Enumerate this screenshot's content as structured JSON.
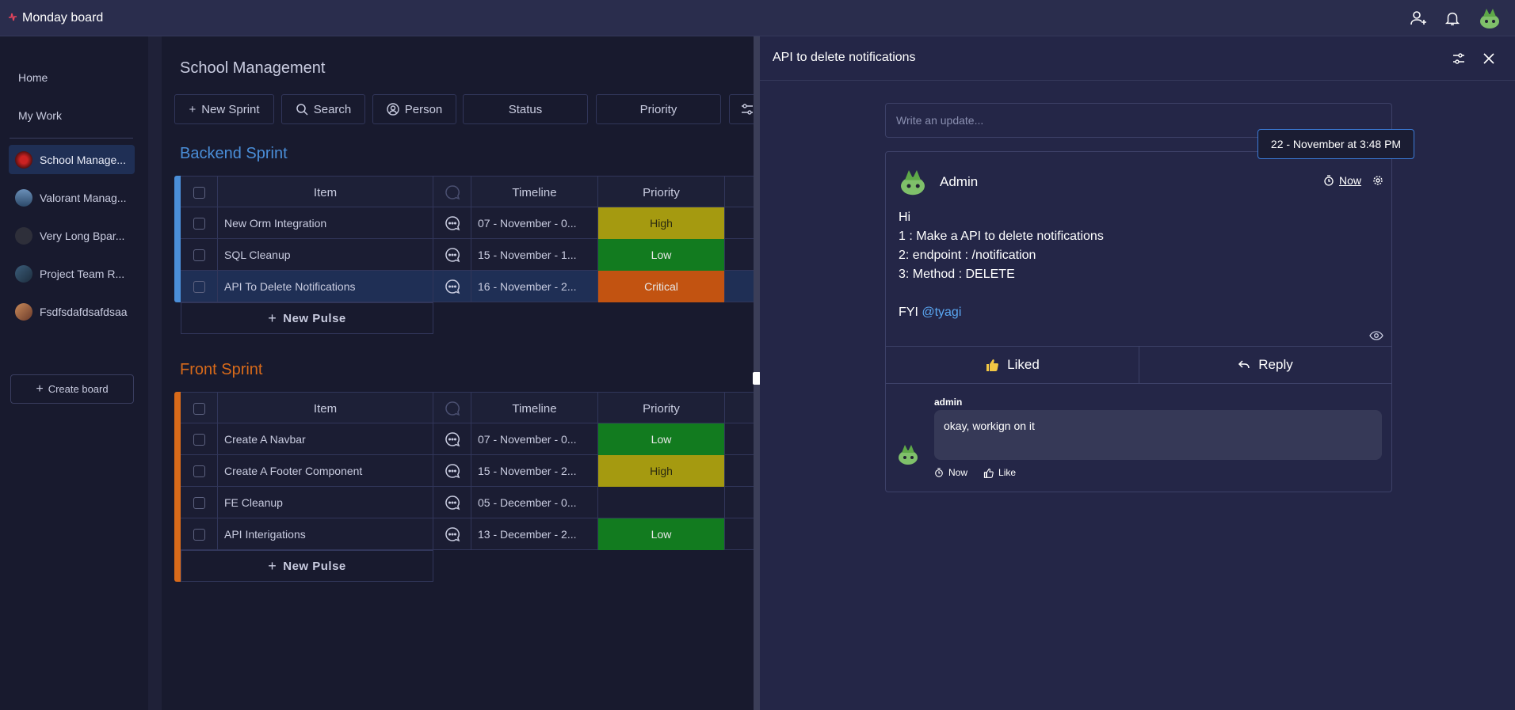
{
  "app": {
    "title": "Monday board"
  },
  "sidebar": {
    "links": [
      {
        "label": "Home"
      },
      {
        "label": "My Work"
      }
    ],
    "boards": [
      {
        "label": "School Manage...",
        "active": true
      },
      {
        "label": "Valorant Manag..."
      },
      {
        "label": "Very Long Bpar..."
      },
      {
        "label": "Project Team R..."
      },
      {
        "label": "Fsdfsdafdsafdsaa"
      }
    ],
    "create_label": "Create board"
  },
  "board": {
    "title": "School Management",
    "toolbar": {
      "new_sprint": "New Sprint",
      "search": "Search",
      "person": "Person",
      "status": "Status",
      "priority": "Priority"
    },
    "columns": {
      "item": "Item",
      "timeline": "Timeline",
      "priority": "Priority"
    },
    "new_pulse_label": "New Pulse",
    "groups": [
      {
        "title": "Backend Sprint",
        "color": "#4a8ed8",
        "rows": [
          {
            "item": "New Orm Integration",
            "timeline": "07 - November - 0...",
            "priority": "High",
            "priority_color": "#a59a10"
          },
          {
            "item": "SQL Cleanup",
            "timeline": "15 - November - 1...",
            "priority": "Low",
            "priority_color": "#127b1f"
          },
          {
            "item": "API To Delete Notifications",
            "timeline": "16 - November - 2...",
            "priority": "Critical",
            "priority_color": "#c25311",
            "selected": true
          }
        ]
      },
      {
        "title": "Front Sprint",
        "color": "#d86a1a",
        "rows": [
          {
            "item": "Create A Navbar",
            "timeline": "07 - November - 0...",
            "priority": "Low",
            "priority_color": "#127b1f"
          },
          {
            "item": "Create A Footer Component",
            "timeline": "15 - November - 2...",
            "priority": "High",
            "priority_color": "#a59a10"
          },
          {
            "item": "FE Cleanup",
            "timeline": "05 - December - 0...",
            "priority": "",
            "priority_color": ""
          },
          {
            "item": "API Interigations",
            "timeline": "13 - December - 2...",
            "priority": "Low",
            "priority_color": "#127b1f"
          }
        ]
      }
    ]
  },
  "panel": {
    "title": "API to delete notifications",
    "update_placeholder": "Write an update...",
    "tooltip": "22 - November at 3:48 PM",
    "post": {
      "author": "Admin",
      "time": "Now",
      "lines": [
        "Hi",
        "1 : Make a API to delete notifications",
        "2: endpoint : /notification",
        "3: Method : DELETE"
      ],
      "fyi": "FYI",
      "mention": "@tyagi",
      "liked_label": "Liked",
      "reply_label": "Reply"
    },
    "reply": {
      "author": "admin",
      "text": "okay, workign on it",
      "time": "Now",
      "like_label": "Like"
    }
  }
}
